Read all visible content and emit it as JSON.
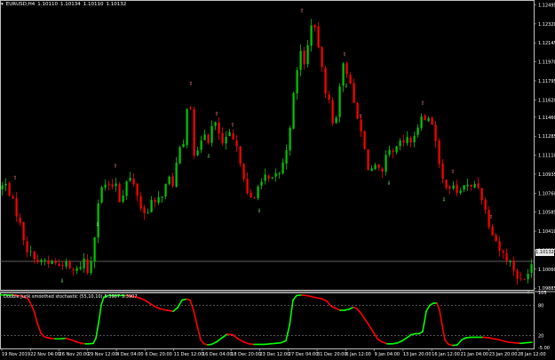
{
  "header": {
    "symbol": "EURUSD,H4",
    "open": "1.10110",
    "high": "1.10134",
    "low": "1.10110",
    "close": "1.10132"
  },
  "subwindow": {
    "name": "Double Jurik smoothed stochastic (55,10,10)",
    "value1": "5.3907",
    "value2": "5.3907"
  },
  "colors": {
    "background": "#000000",
    "bull_candle": "#00c800",
    "bear_candle": "#ff0000",
    "grid_border": "#c0c0c0",
    "price_line": "#808080",
    "fractal_marker": "#ff8080",
    "fractal_marker_low": "#80ff80",
    "stoch_up": "#00ff00",
    "stoch_down": "#ff0000"
  },
  "chart_data": [
    {
      "type": "candlestick",
      "title": "EURUSD,H4",
      "y_ticks": [
        "1.12495",
        "1.12320",
        "1.12145",
        "1.11970",
        "1.11795",
        "1.11620",
        "1.11460",
        "1.11285",
        "1.11110",
        "1.10935",
        "1.10760",
        "1.10585",
        "1.10410",
        "1.10235",
        "1.10060",
        "1.09885"
      ],
      "current_price": "1.10132",
      "ylim": [
        1.0987,
        1.1254
      ],
      "x_labels": [
        "19 Nov 2019",
        "22 Nov 04:00",
        "26 Nov 20:00",
        "29 Nov 12:00",
        "4 Dec 04:00",
        "6 Dec 20:00",
        "11 Dec 12:00",
        "16 Dec 04:00",
        "18 Dec 20:00",
        "23 Dec 12:00",
        "27 Dec 04:00",
        "31 Dec 20:00",
        "6 Jan 12:00",
        "9 Jan 04:00",
        "13 Jan 20:00",
        "16 Jan 12:00",
        "21 Jan 04:00",
        "23 Jan 20:00",
        "28 Jan 12:00"
      ],
      "close_path": [
        [
          0,
          1.108
        ],
        [
          6,
          1.1085
        ],
        [
          12,
          1.1075
        ],
        [
          18,
          1.106
        ],
        [
          22,
          1.105
        ],
        [
          26,
          1.1038
        ],
        [
          30,
          1.1025
        ],
        [
          35,
          1.102
        ],
        [
          40,
          1.1018
        ],
        [
          45,
          1.101
        ],
        [
          50,
          1.1015
        ],
        [
          55,
          1.101
        ],
        [
          60,
          1.1015
        ],
        [
          65,
          1.1008
        ],
        [
          70,
          1.1012
        ],
        [
          75,
          1.101
        ],
        [
          80,
          1.1005
        ],
        [
          85,
          1.1003
        ],
        [
          90,
          1.1008
        ],
        [
          95,
          1.1015
        ],
        [
          100,
          1.1
        ],
        [
          103,
          1.1015
        ],
        [
          106,
          1.103
        ],
        [
          110,
          1.1065
        ],
        [
          115,
          1.108
        ],
        [
          120,
          1.1085
        ],
        [
          125,
          1.1078
        ],
        [
          130,
          1.109
        ],
        [
          135,
          1.107
        ],
        [
          140,
          1.1078
        ],
        [
          145,
          1.1092
        ],
        [
          150,
          1.1085
        ],
        [
          155,
          1.1075
        ],
        [
          160,
          1.106
        ],
        [
          165,
          1.1055
        ],
        [
          170,
          1.107
        ],
        [
          175,
          1.1065
        ],
        [
          180,
          1.1072
        ],
        [
          185,
          1.1078
        ],
        [
          190,
          1.109
        ],
        [
          195,
          1.1085
        ],
        [
          198,
          1.11
        ],
        [
          203,
          1.1115
        ],
        [
          207,
          1.112
        ],
        [
          210,
          1.115
        ],
        [
          213,
          1.117
        ],
        [
          216,
          1.115
        ],
        [
          220,
          1.11
        ],
        [
          225,
          1.112
        ],
        [
          230,
          1.1135
        ],
        [
          235,
          1.1125
        ],
        [
          240,
          1.114
        ],
        [
          245,
          1.1138
        ],
        [
          250,
          1.112
        ],
        [
          255,
          1.1125
        ],
        [
          260,
          1.113
        ],
        [
          265,
          1.112
        ],
        [
          270,
          1.111
        ],
        [
          275,
          1.1092
        ],
        [
          280,
          1.107
        ],
        [
          284,
          1.107
        ],
        [
          288,
          1.1072
        ],
        [
          292,
          1.109
        ],
        [
          296,
          1.1085
        ],
        [
          300,
          1.1092
        ],
        [
          305,
          1.1085
        ],
        [
          310,
          1.1092
        ],
        [
          315,
          1.1095
        ],
        [
          320,
          1.1105
        ],
        [
          325,
          1.1125
        ],
        [
          330,
          1.116
        ],
        [
          335,
          1.1188
        ],
        [
          338,
          1.1215
        ],
        [
          342,
          1.119
        ],
        [
          346,
          1.1205
        ],
        [
          350,
          1.123
        ],
        [
          353,
          1.124
        ],
        [
          356,
          1.1218
        ],
        [
          360,
          1.121
        ],
        [
          365,
          1.1175
        ],
        [
          370,
          1.1165
        ],
        [
          375,
          1.114
        ],
        [
          380,
          1.115
        ],
        [
          385,
          1.1195
        ],
        [
          390,
          1.119
        ],
        [
          395,
          1.118
        ],
        [
          400,
          1.115
        ],
        [
          405,
          1.114
        ],
        [
          410,
          1.112
        ],
        [
          415,
          1.11
        ],
        [
          420,
          1.1098
        ],
        [
          425,
          1.11
        ],
        [
          430,
          1.109
        ],
        [
          435,
          1.1108
        ],
        [
          440,
          1.1115
        ],
        [
          445,
          1.111
        ],
        [
          450,
          1.1125
        ],
        [
          455,
          1.112
        ],
        [
          460,
          1.113
        ],
        [
          465,
          1.112
        ],
        [
          470,
          1.1135
        ],
        [
          475,
          1.115
        ],
        [
          480,
          1.114
        ],
        [
          485,
          1.115
        ],
        [
          490,
          1.113
        ],
        [
          493,
          1.111
        ],
        [
          497,
          1.109
        ],
        [
          502,
          1.1085
        ],
        [
          507,
          1.1082
        ],
        [
          512,
          1.108
        ],
        [
          518,
          1.1075
        ],
        [
          522,
          1.1085
        ],
        [
          527,
          1.1082
        ],
        [
          532,
          1.108
        ],
        [
          537,
          1.1088
        ],
        [
          542,
          1.1075
        ],
        [
          547,
          1.106
        ],
        [
          552,
          1.1045
        ],
        [
          557,
          1.1038
        ],
        [
          562,
          1.1025
        ],
        [
          567,
          1.102
        ],
        [
          572,
          1.1015
        ],
        [
          577,
          1.101
        ],
        [
          582,
          1.1
        ],
        [
          587,
          1.0995
        ],
        [
          591,
          1.0996
        ],
        [
          595,
          1.1005
        ],
        [
          599,
          1.1012
        ]
      ]
    },
    {
      "type": "line",
      "title": "Double Jurik smoothed stochastic (55,10,10)",
      "y_ticks": [
        "105",
        "80",
        "20",
        "-5.00"
      ],
      "levels": [
        80,
        20
      ],
      "ylim": [
        -5,
        105
      ],
      "series": [
        {
          "values": [
            [
              0,
              100
            ],
            [
              15,
              100
            ],
            [
              25,
              98
            ],
            [
              32,
              92
            ],
            [
              38,
              70
            ],
            [
              42,
              45
            ],
            [
              46,
              25
            ],
            [
              50,
              18
            ],
            [
              56,
              15
            ],
            [
              62,
              14
            ],
            [
              68,
              14
            ],
            [
              74,
              15
            ],
            [
              80,
              12
            ],
            [
              86,
              8
            ],
            [
              92,
              5
            ],
            [
              96,
              4
            ],
            [
              100,
              4
            ],
            [
              105,
              5
            ],
            [
              108,
              15
            ],
            [
              111,
              45
            ],
            [
              114,
              80
            ],
            [
              117,
              96
            ],
            [
              122,
              99
            ],
            [
              128,
              99
            ],
            [
              135,
              99
            ],
            [
              142,
              99
            ],
            [
              150,
              97
            ],
            [
              158,
              94
            ],
            [
              165,
              88
            ],
            [
              170,
              82
            ],
            [
              176,
              76
            ],
            [
              182,
              72
            ],
            [
              188,
              70
            ],
            [
              195,
              68
            ],
            [
              200,
              75
            ],
            [
              205,
              90
            ],
            [
              210,
              92
            ],
            [
              214,
              90
            ],
            [
              218,
              70
            ],
            [
              222,
              40
            ],
            [
              226,
              12
            ],
            [
              230,
              4
            ],
            [
              234,
              2
            ],
            [
              238,
              3
            ],
            [
              244,
              8
            ],
            [
              250,
              16
            ],
            [
              256,
              23
            ],
            [
              262,
              22
            ],
            [
              268,
              14
            ],
            [
              274,
              8
            ],
            [
              280,
              4
            ],
            [
              286,
              3
            ],
            [
              292,
              3
            ],
            [
              298,
              3
            ],
            [
              304,
              4
            ],
            [
              310,
              5
            ],
            [
              316,
              6
            ],
            [
              322,
              10
            ],
            [
              326,
              40
            ],
            [
              330,
              90
            ],
            [
              334,
              99
            ],
            [
              340,
              100
            ],
            [
              348,
              98
            ],
            [
              355,
              95
            ],
            [
              362,
              93
            ],
            [
              368,
              88
            ],
            [
              373,
              78
            ],
            [
              378,
              74
            ],
            [
              383,
              70
            ],
            [
              388,
              70
            ],
            [
              393,
              72
            ],
            [
              398,
              76
            ],
            [
              402,
              73
            ],
            [
              406,
              65
            ],
            [
              410,
              55
            ],
            [
              415,
              42
            ],
            [
              420,
              28
            ],
            [
              425,
              14
            ],
            [
              430,
              8
            ],
            [
              436,
              4
            ],
            [
              442,
              4
            ],
            [
              448,
              6
            ],
            [
              453,
              10
            ],
            [
              458,
              16
            ],
            [
              463,
              22
            ],
            [
              468,
              24
            ],
            [
              472,
              24
            ],
            [
              476,
              28
            ],
            [
              480,
              68
            ],
            [
              484,
              80
            ],
            [
              488,
              84
            ],
            [
              492,
              84
            ],
            [
              495,
              70
            ],
            [
              498,
              40
            ],
            [
              501,
              12
            ],
            [
              505,
              3
            ],
            [
              510,
              1
            ],
            [
              515,
              2
            ],
            [
              520,
              12
            ],
            [
              525,
              16
            ],
            [
              530,
              17
            ],
            [
              536,
              17
            ],
            [
              544,
              17
            ],
            [
              550,
              16
            ],
            [
              556,
              14
            ],
            [
              562,
              12
            ],
            [
              568,
              9
            ],
            [
              574,
              7
            ],
            [
              580,
              6
            ],
            [
              586,
              5
            ],
            [
              592,
              6
            ],
            [
              599,
              7
            ]
          ]
        }
      ]
    }
  ]
}
